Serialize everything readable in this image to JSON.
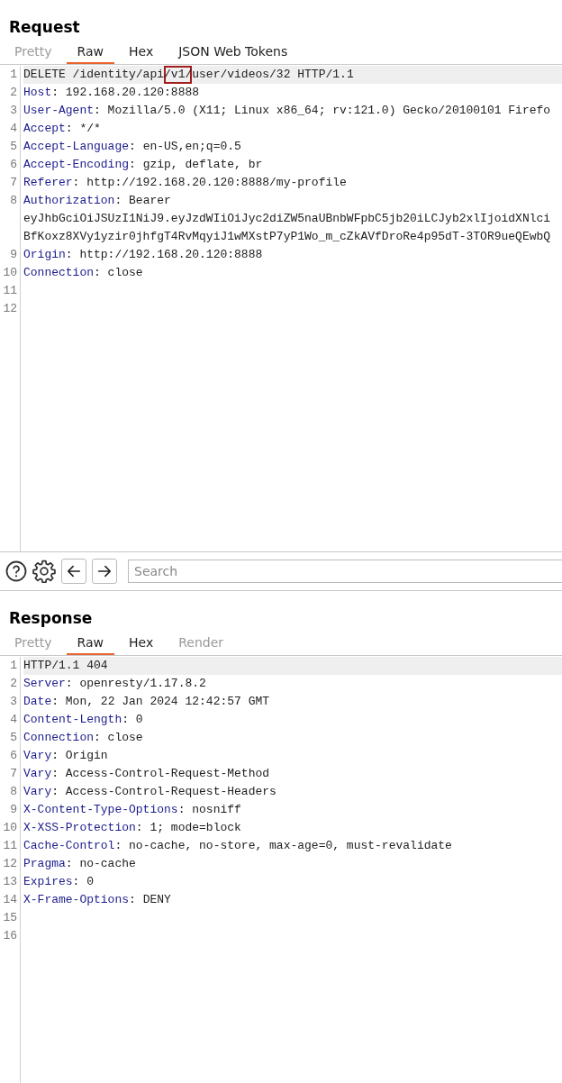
{
  "panels": [
    {
      "title": "Request",
      "tabs": [
        {
          "label": "Pretty",
          "selected": false,
          "disabled": true
        },
        {
          "label": "Raw",
          "selected": true,
          "disabled": false
        },
        {
          "label": "Hex",
          "selected": false,
          "disabled": false
        },
        {
          "label": "JSON Web Tokens",
          "selected": false,
          "disabled": false
        }
      ],
      "lines": [
        {
          "number": "1",
          "current": true,
          "parts": [
            {
              "text": "DELETE /identity/api",
              "marked": false
            },
            {
              "text": "/v1/",
              "marked": true
            },
            {
              "text": "user/videos/32 HTTP/1.1",
              "marked": false
            }
          ]
        },
        {
          "number": "2",
          "name": "Host",
          "value": ": 192.168.20.120:8888"
        },
        {
          "number": "3",
          "name": "User-Agent",
          "value": ": Mozilla/5.0 (X11; Linux x86_64; rv:121.0) Gecko/20100101 Firefo"
        },
        {
          "number": "4",
          "name": "Accept",
          "value": ": */*"
        },
        {
          "number": "5",
          "name": "Accept-Language",
          "value": ": en-US,en;q=0.5"
        },
        {
          "number": "6",
          "name": "Accept-Encoding",
          "value": ": gzip, deflate, br"
        },
        {
          "number": "7",
          "name": "Referer",
          "value": ": http://192.168.20.120:8888/my-profile"
        },
        {
          "number": "8",
          "name": "Authorization",
          "value": ": Bearer",
          "wrapped": [
            "eyJhbGciOiJSUzI1NiJ9.eyJzdWIiOiJyc2diZW5naUBnbWFpbC5jb20iLCJyb2xlIjoidXNlci",
            "BfKoxz8XVy1yzir0jhfgT4RvMqyiJ1wMXstP7yP1Wo_m_cZkAVfDroRe4p95dT-3TOR9ueQEwbQ"
          ]
        },
        {
          "number": "9",
          "name": "Origin",
          "value": ": http://192.168.20.120:8888"
        },
        {
          "number": "10",
          "name": "Connection",
          "value": ": close"
        },
        {
          "number": "11"
        },
        {
          "number": "12"
        }
      ]
    },
    {
      "title": "Response",
      "tabs": [
        {
          "label": "Pretty",
          "selected": false,
          "disabled": true
        },
        {
          "label": "Raw",
          "selected": true,
          "disabled": false
        },
        {
          "label": "Hex",
          "selected": false,
          "disabled": false
        },
        {
          "label": "Render",
          "selected": false,
          "disabled": true
        }
      ],
      "lines": [
        {
          "number": "1",
          "current": true,
          "parts": [
            {
              "text": "HTTP/1.1 404",
              "marked": false
            }
          ]
        },
        {
          "number": "2",
          "name": "Server",
          "value": ": openresty/1.17.8.2"
        },
        {
          "number": "3",
          "name": "Date",
          "value": ": Mon, 22 Jan 2024 12:42:57 GMT"
        },
        {
          "number": "4",
          "name": "Content-Length",
          "value": ": 0"
        },
        {
          "number": "5",
          "name": "Connection",
          "value": ": close"
        },
        {
          "number": "6",
          "name": "Vary",
          "value": ": Origin"
        },
        {
          "number": "7",
          "name": "Vary",
          "value": ": Access-Control-Request-Method"
        },
        {
          "number": "8",
          "name": "Vary",
          "value": ": Access-Control-Request-Headers"
        },
        {
          "number": "9",
          "name": "X-Content-Type-Options",
          "value": ": nosniff"
        },
        {
          "number": "10",
          "name": "X-XSS-Protection",
          "value": ": 1; mode=block"
        },
        {
          "number": "11",
          "name": "Cache-Control",
          "value": ": no-cache, no-store, max-age=0, must-revalidate"
        },
        {
          "number": "12",
          "name": "Pragma",
          "value": ": no-cache"
        },
        {
          "number": "13",
          "name": "Expires",
          "value": ": 0"
        },
        {
          "number": "14",
          "name": "X-Frame-Options",
          "value": ": DENY"
        },
        {
          "number": "15"
        },
        {
          "number": "16"
        }
      ]
    }
  ],
  "toolbar": {
    "search": {
      "placeholder": "Search"
    }
  }
}
